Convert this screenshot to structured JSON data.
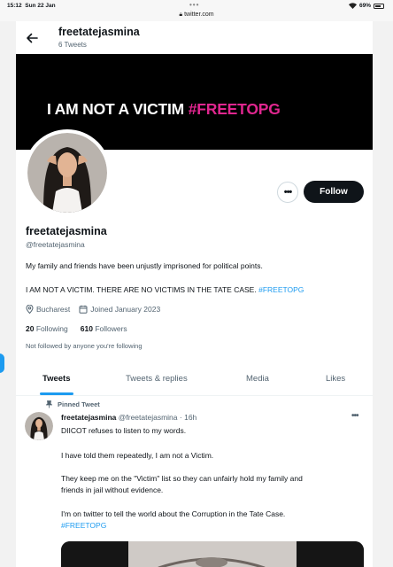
{
  "status_bar": {
    "time": "15:12",
    "date": "Sun 22 Jan",
    "url": "twitter.com",
    "battery": "69%"
  },
  "topbar": {
    "name": "freetatejasmina",
    "tweet_count": "6 Tweets"
  },
  "banner": {
    "text_white": "I AM NOT A VICTIM",
    "text_pink": "#FREETOPG",
    "pink_color": "#e0268f"
  },
  "actions": {
    "follow_label": "Follow",
    "more_label": "•••"
  },
  "profile": {
    "name": "freetatejasmina",
    "handle": "@freetatejasmina",
    "bio_line1": "My family and friends have been unjustly imprisoned for political points.",
    "bio_line2_text": "I AM NOT A VICTIM. THERE ARE NO VICTIMS IN THE TATE CASE.",
    "bio_line2_hashtag": "#FREETOPG",
    "location": "Bucharest",
    "joined": "Joined January 2023",
    "following_count": "20",
    "following_label": "Following",
    "followers_count": "610",
    "followers_label": "Followers",
    "not_followed": "Not followed by anyone you're following"
  },
  "tabs": [
    {
      "label": "Tweets",
      "active": true
    },
    {
      "label": "Tweets & replies",
      "active": false
    },
    {
      "label": "Media",
      "active": false
    },
    {
      "label": "Likes",
      "active": false
    }
  ],
  "tweet": {
    "pinned_label": "Pinned Tweet",
    "author": "freetatejasmina",
    "handle": "@freetatejasmina",
    "separator": "·",
    "time": "16h",
    "lines": [
      "DIICOT refuses to listen to my words.",
      "I have told them repeatedly, I am not a Victim.",
      "They keep me on the \"Victim\" list so they can unfairly hold my family and",
      "friends in jail without evidence.",
      "I'm on twitter to tell the world about the Corruption in the Tate Case."
    ],
    "hashtag": "#FREETOPG",
    "more_label": "•••"
  },
  "colors": {
    "accent": "#1d9bf0",
    "text": "#0f1419",
    "muted": "#536471"
  }
}
